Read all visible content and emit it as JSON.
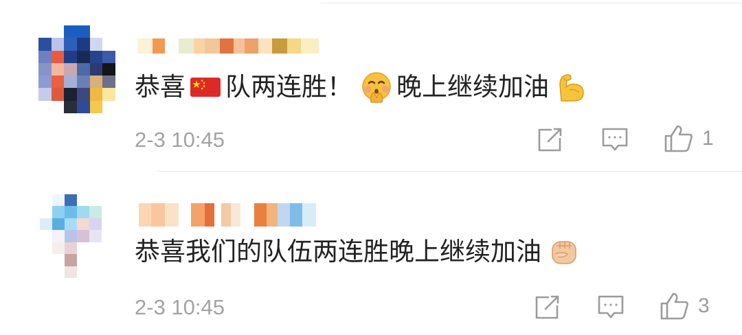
{
  "comments": [
    {
      "text_parts": [
        "恭喜",
        "队两连胜！",
        "晚上继续加油"
      ],
      "emojis": [
        "china-flag",
        "pleading-face",
        "flexed-biceps"
      ],
      "timestamp": "2-3 10:45",
      "like_count": "1"
    },
    {
      "text_parts": [
        "恭喜我们的队伍两连胜晚上继续加油"
      ],
      "emojis": [
        "raised-fist"
      ],
      "timestamp": "2-3 10:45",
      "like_count": "3"
    }
  ],
  "colors": {
    "text": "#222222",
    "meta": "#a3a3a3",
    "icon": "#9b9b9b",
    "divider": "#e9e9e9"
  }
}
